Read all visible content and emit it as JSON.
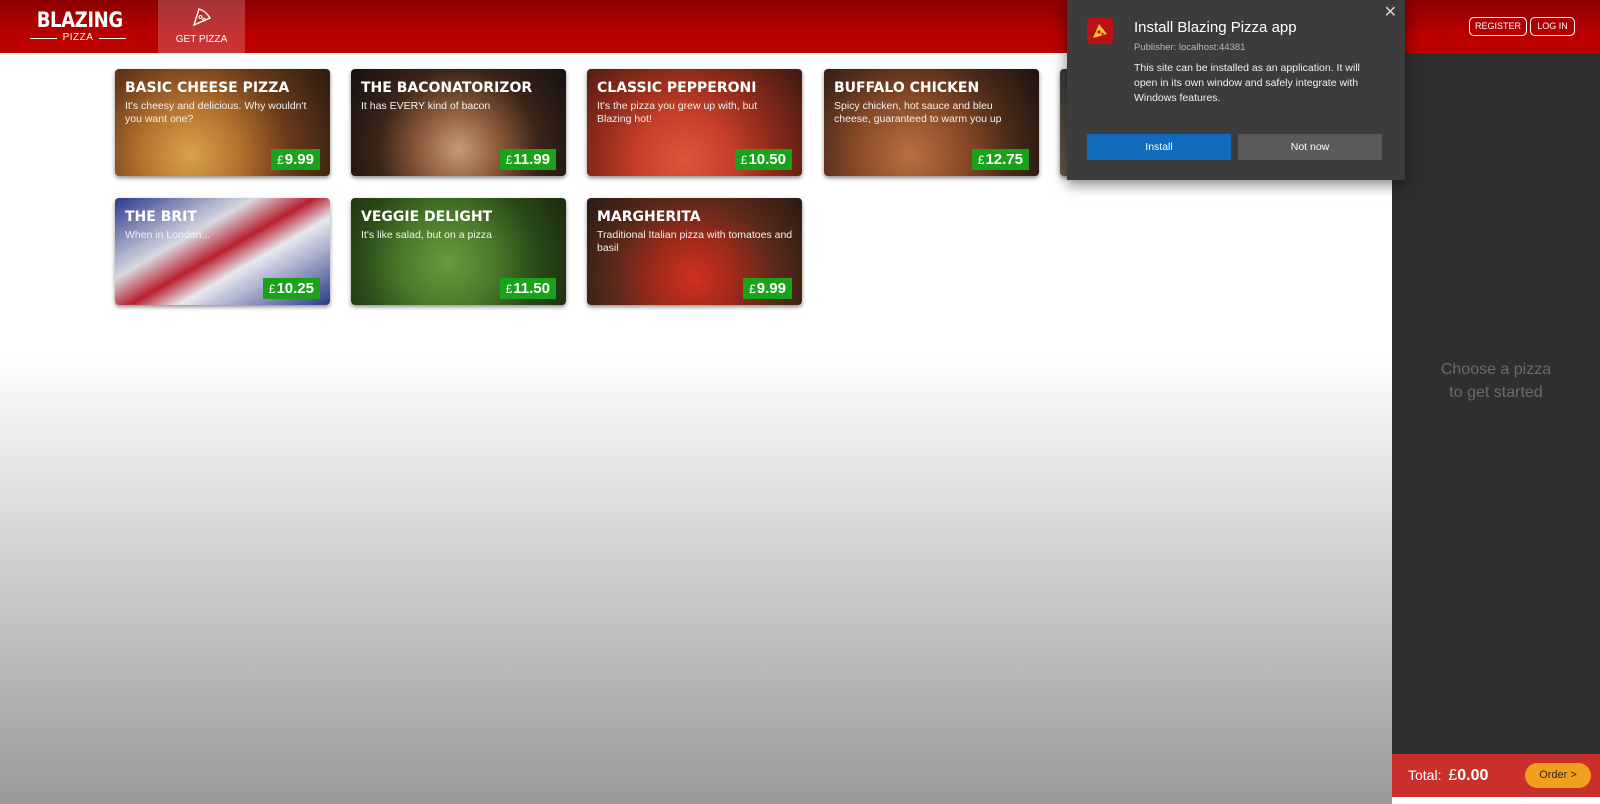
{
  "header": {
    "logo_main": "BLAZING",
    "logo_sub": "PIZZA",
    "nav_tab_label": "GET PIZZA",
    "register_label": "REGISTER",
    "login_label": "LOG IN",
    "brand_color": "#b80000"
  },
  "pizzas": [
    {
      "name": "BASIC CHEESE PIZZA",
      "description": "It's cheesy and delicious. Why wouldn't you want one?",
      "currency": "£",
      "price": "9.99"
    },
    {
      "name": "THE BACONATORIZOR",
      "description": "It has EVERY kind of bacon",
      "currency": "£",
      "price": "11.99"
    },
    {
      "name": "CLASSIC PEPPERONI",
      "description": "It's the pizza you grew up with, but Blazing hot!",
      "currency": "£",
      "price": "10.50"
    },
    {
      "name": "BUFFALO CHICKEN",
      "description": "Spicy chicken, hot sauce and bleu cheese, guaranteed to warm you up",
      "currency": "£",
      "price": "12.75"
    },
    {
      "name": "THE BRIT",
      "description": "When in London...",
      "currency": "£",
      "price": "10.25"
    },
    {
      "name": "VEGGIE DELIGHT",
      "description": "It's like salad, but on a pizza",
      "currency": "£",
      "price": "11.50"
    },
    {
      "name": "MARGHERITA",
      "description": "Traditional Italian pizza with tomatoes and basil",
      "currency": "£",
      "price": "9.99"
    }
  ],
  "sidebar": {
    "empty_line1": "Choose a pizza",
    "empty_line2": "to get started",
    "total_label": "Total:",
    "total_currency": "£",
    "total_amount": "0.00",
    "order_label": "Order >"
  },
  "install_popup": {
    "title": "Install Blazing Pizza app",
    "publisher": "Publisher: localhost:44381",
    "body": "This site can be installed as an application. It will open in its own window and safely integrate with Windows features.",
    "install_label": "Install",
    "not_now_label": "Not now",
    "close_icon": "close-icon"
  },
  "colors": {
    "price_badge": "#1aa31a",
    "order_bar": "#c9302c",
    "order_button": "#f0a01a",
    "install_button": "#0f6cbd"
  }
}
